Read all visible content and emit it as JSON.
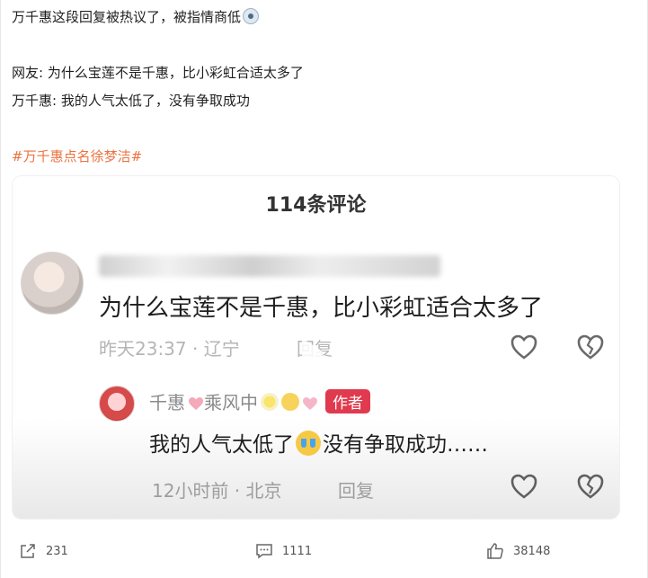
{
  "post": {
    "line1": "万千惠这段回复被热议了，被指情商低",
    "line2": "网友: 为什么宝莲不是千惠，比小彩虹合适太多了",
    "line3": "万千惠: 我的人气太低了，没有争取成功",
    "hashtag": "#万千惠点名徐梦洁#"
  },
  "screenshot": {
    "title": "114条评论",
    "comment1": {
      "text": "为什么宝莲不是千惠，比小彩虹适合太多了",
      "time_location": "昨天23:37 · 辽宁",
      "reply": "回复"
    },
    "comment2": {
      "name": "千惠",
      "name_suffix": "乘风中",
      "badge": "作者",
      "text_before": "我的人气太低了",
      "text_after": "没有争取成功……",
      "time_location": "12小时前 · 北京",
      "reply": "回复"
    }
  },
  "actions": {
    "share_count": "231",
    "comment_count": "1111",
    "like_count": "38148"
  },
  "colors": {
    "hashtag": "#eb7340",
    "author_badge": "#e03a4f",
    "text": "#1f1f1f",
    "meta": "#b5b5b5"
  },
  "icons": [
    "share-icon",
    "comment-icon",
    "like-icon",
    "heart-icon",
    "broken-heart-icon",
    "play-icon"
  ]
}
